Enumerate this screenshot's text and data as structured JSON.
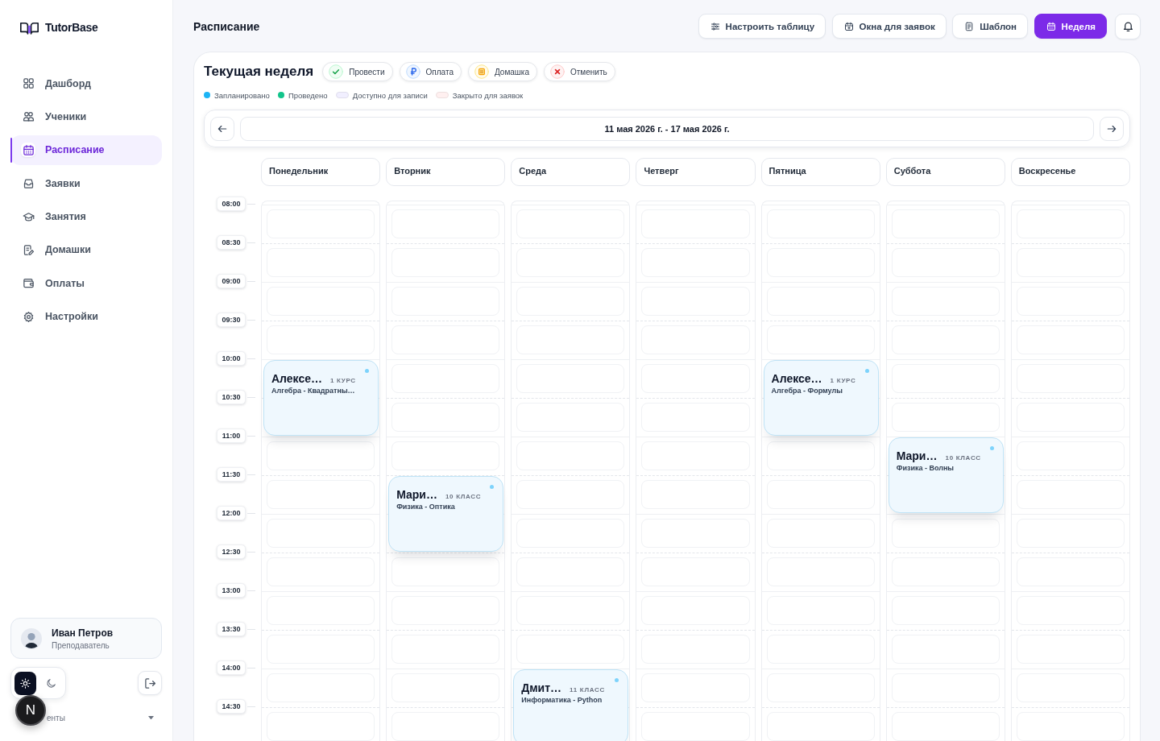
{
  "sidebar": {
    "logo": "TutorBase",
    "items": [
      {
        "label": "Дашборд",
        "selected": false
      },
      {
        "label": "Ученики",
        "selected": false
      },
      {
        "label": "Расписание",
        "selected": true
      },
      {
        "label": "Заявки",
        "selected": false
      },
      {
        "label": "Занятия",
        "selected": false
      },
      {
        "label": "Домашки",
        "selected": false
      },
      {
        "label": "Оплаты",
        "selected": false
      },
      {
        "label": "Настройки",
        "selected": false
      }
    ],
    "user": {
      "name": "Иван Петров",
      "role": "Преподаватель"
    },
    "theme_options": [
      {
        "kind": "light",
        "selected": true
      },
      {
        "kind": "dark",
        "selected": false
      }
    ],
    "section": {
      "label": "енты"
    },
    "dev_badge": "N"
  },
  "header": {
    "title": "Расписание",
    "buttons": [
      {
        "label": "Настроить таблицу",
        "selected": false
      },
      {
        "label": "Окна для заявок",
        "selected": false
      },
      {
        "label": "Шаблон",
        "selected": false
      },
      {
        "label": "Неделя",
        "selected": true
      }
    ]
  },
  "week": {
    "title": "Текущая неделя",
    "actions": [
      {
        "kind": "conduct",
        "label": "Провести"
      },
      {
        "kind": "payment",
        "label": "Оплата"
      },
      {
        "kind": "homework",
        "label": "Домашка"
      },
      {
        "kind": "cancel",
        "label": "Отменить"
      }
    ],
    "legend": [
      {
        "kind": "dot",
        "label": "Запланировано",
        "color": "#1cb4f5"
      },
      {
        "kind": "dot",
        "label": "Проведено",
        "color": "#12c48b"
      },
      {
        "kind": "swatch",
        "label": "Доступно для записи",
        "color": "#f1efff"
      },
      {
        "kind": "swatch",
        "label": "Закрыто для заявок",
        "color": "#fff0f0"
      }
    ],
    "range": "11 мая 2026 г. - 17 мая 2026 г.",
    "times": [
      "08:00",
      "08:30",
      "09:00",
      "09:30",
      "10:00",
      "10:30",
      "11:00",
      "11:30",
      "12:00",
      "12:30",
      "13:00",
      "13:30",
      "14:00",
      "14:30"
    ],
    "days": [
      {
        "name": "Понедельник",
        "slots": [
          {
            "kind": "free"
          },
          {
            "kind": "free"
          },
          {
            "kind": "free"
          },
          {
            "kind": "free"
          },
          {
            "kind": "lesson",
            "student": "Алексе…",
            "grade": "1 КУРС",
            "subject": "Алгебра - Квадратны…",
            "completed": false
          },
          {
            "kind": "continued"
          },
          {
            "kind": "free"
          },
          {
            "kind": "free"
          },
          {
            "kind": "free"
          },
          {
            "kind": "free"
          },
          {
            "kind": "free"
          },
          {
            "kind": "free"
          },
          {
            "kind": "free"
          },
          {
            "kind": "free"
          }
        ]
      },
      {
        "name": "Вторник",
        "slots": [
          {
            "kind": "free"
          },
          {
            "kind": "free"
          },
          {
            "kind": "free"
          },
          {
            "kind": "free"
          },
          {
            "kind": "free"
          },
          {
            "kind": "free"
          },
          {
            "kind": "free"
          },
          {
            "kind": "lesson",
            "student": "Мари…",
            "grade": "10 КЛАСС",
            "subject": "Физика - Оптика",
            "completed": false
          },
          {
            "kind": "continued"
          },
          {
            "kind": "free"
          },
          {
            "kind": "free"
          },
          {
            "kind": "free"
          },
          {
            "kind": "free"
          },
          {
            "kind": "free"
          }
        ]
      },
      {
        "name": "Среда",
        "slots": [
          {
            "kind": "free"
          },
          {
            "kind": "free"
          },
          {
            "kind": "free"
          },
          {
            "kind": "free"
          },
          {
            "kind": "free"
          },
          {
            "kind": "free"
          },
          {
            "kind": "free"
          },
          {
            "kind": "free"
          },
          {
            "kind": "free"
          },
          {
            "kind": "free"
          },
          {
            "kind": "free"
          },
          {
            "kind": "free"
          },
          {
            "kind": "lesson",
            "student": "Дмит…",
            "grade": "11 КЛАСС",
            "subject": "Информатика - Python",
            "completed": false
          },
          {
            "kind": "continued"
          }
        ]
      },
      {
        "name": "Четверг",
        "slots": [
          {
            "kind": "free"
          },
          {
            "kind": "free"
          },
          {
            "kind": "free"
          },
          {
            "kind": "free"
          },
          {
            "kind": "free"
          },
          {
            "kind": "free"
          },
          {
            "kind": "free"
          },
          {
            "kind": "free"
          },
          {
            "kind": "free"
          },
          {
            "kind": "free"
          },
          {
            "kind": "free"
          },
          {
            "kind": "free"
          },
          {
            "kind": "free"
          },
          {
            "kind": "free"
          }
        ]
      },
      {
        "name": "Пятница",
        "slots": [
          {
            "kind": "free"
          },
          {
            "kind": "free"
          },
          {
            "kind": "free"
          },
          {
            "kind": "free"
          },
          {
            "kind": "lesson",
            "student": "Алексе…",
            "grade": "1 КУРС",
            "subject": "Алгебра - Формулы",
            "completed": false
          },
          {
            "kind": "continued"
          },
          {
            "kind": "free"
          },
          {
            "kind": "free"
          },
          {
            "kind": "free"
          },
          {
            "kind": "free"
          },
          {
            "kind": "free"
          },
          {
            "kind": "free"
          },
          {
            "kind": "free"
          },
          {
            "kind": "free"
          }
        ]
      },
      {
        "name": "Суббота",
        "slots": [
          {
            "kind": "free"
          },
          {
            "kind": "free"
          },
          {
            "kind": "free"
          },
          {
            "kind": "free"
          },
          {
            "kind": "free"
          },
          {
            "kind": "free"
          },
          {
            "kind": "lesson",
            "student": "Мари…",
            "grade": "10 КЛАСС",
            "subject": "Физика - Волны",
            "completed": false
          },
          {
            "kind": "continued"
          },
          {
            "kind": "free"
          },
          {
            "kind": "free"
          },
          {
            "kind": "free"
          },
          {
            "kind": "free"
          },
          {
            "kind": "free"
          },
          {
            "kind": "free"
          }
        ]
      },
      {
        "name": "Воскресенье",
        "slots": [
          {
            "kind": "free"
          },
          {
            "kind": "free"
          },
          {
            "kind": "free"
          },
          {
            "kind": "free"
          },
          {
            "kind": "free"
          },
          {
            "kind": "free"
          },
          {
            "kind": "free"
          },
          {
            "kind": "free"
          },
          {
            "kind": "free"
          },
          {
            "kind": "free"
          },
          {
            "kind": "free"
          },
          {
            "kind": "free"
          },
          {
            "kind": "free"
          },
          {
            "kind": "free"
          }
        ]
      }
    ]
  }
}
